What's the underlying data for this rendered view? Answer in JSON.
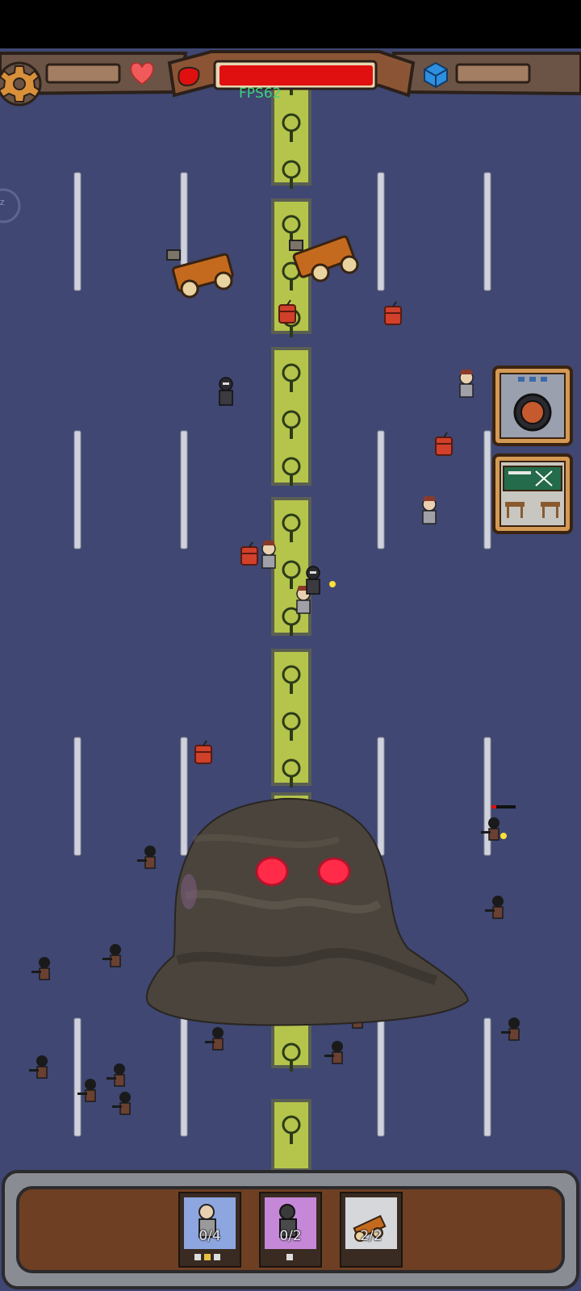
{
  "hud": {
    "fps": "FPS62",
    "colors": {
      "health_bar": "#e01010",
      "frame": "#6b5445",
      "road": "#3f4772",
      "median": "#b5c44b"
    }
  },
  "icons": {
    "settings": "gear-icon",
    "life": "heart-icon",
    "boss_health": "red-blob-icon",
    "resource": "blue-cube-icon",
    "sleep": "zz-icon"
  },
  "side_buttons": [
    {
      "name": "speaker-skill",
      "icon": "speaker-icon"
    },
    {
      "name": "basic-skill",
      "icon": "classroom-icon"
    }
  ],
  "deploy_slots": [
    {
      "name": "gunman",
      "count": "0/4"
    },
    {
      "name": "special-ops",
      "count": "0/2"
    },
    {
      "name": "catapult",
      "count": "2/2"
    }
  ],
  "boss": {
    "name": "mud-blob-boss"
  }
}
